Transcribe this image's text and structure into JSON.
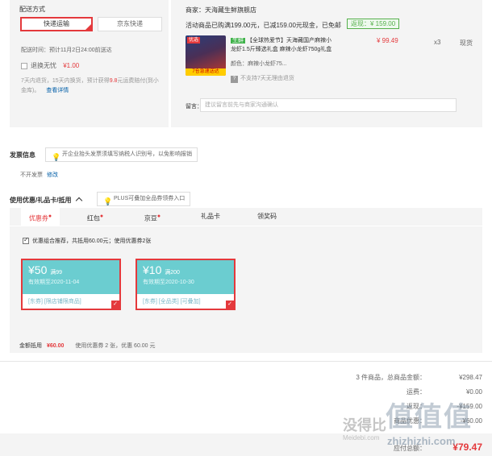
{
  "delivery": {
    "title": "配送方式",
    "options": [
      "快递运输",
      "京东快递"
    ],
    "selected_index": 0,
    "time_label": "配送时间：",
    "time_value": "预计11月2日24:00前送达",
    "return_insurance_label": "退换无忧",
    "return_insurance_price": "¥1.00",
    "return_insurance_desc_1": "7天内退货，15天内换货，预计获得",
    "return_insurance_amount": "9.8",
    "return_insurance_desc_2": "元运费赔付(到小",
    "return_insurance_desc_3": "金库)。",
    "return_insurance_link": "查看详情"
  },
  "shop": {
    "merchant_label": "商家：",
    "merchant_name": "天海藏生鲜旗舰店",
    "promo_text": "活动商品已购满199.00元，已减159.00元现金，已免邮",
    "return_badge": "返现：¥ 159.00",
    "product": {
      "image_corner": "优选",
      "image_label": "7仓急速送达",
      "tag": "生鲜",
      "name_line1": "【全球热爱节】天海藏国产麻辣小",
      "name_line2": "龙虾1.5斤臻选礼盒 麻辣小龙虾750g礼盒",
      "price": "¥ 99.49",
      "qty": "x3",
      "stock": "现货",
      "color_label": "颜色：",
      "color_value": "麻辣小龙虾75...",
      "no_return_icon": "?",
      "no_return": "不支持7天无理由退货"
    },
    "note_label": "留言：",
    "note_placeholder": "建议留言前先与商家沟通确认"
  },
  "invoice": {
    "title": "发票信息",
    "hint": "开企业抬头发票须填写纳税人识别号，以免影响报销",
    "value": "不开发票",
    "modify": "修改"
  },
  "coupons": {
    "title": "使用优惠/礼品卡/抵用",
    "toggle_icon": "chevron-up-icon",
    "hint": "PLUS可叠加全品券领券入口",
    "tabs": [
      {
        "label": "优惠券",
        "dot": true
      },
      {
        "label": "红包",
        "dot": true
      },
      {
        "label": "京豆",
        "dot": true
      },
      {
        "label": "礼品卡",
        "dot": false
      },
      {
        "label": "领奖码",
        "dot": false
      }
    ],
    "active_tab": 0,
    "recommend_text": "优惠组合推荐，共抵用60.00元；使用优惠券2张",
    "items": [
      {
        "amount": "¥50",
        "condition": "满99",
        "expire": "有效期至2020-11-04",
        "tags": "[东券] [限店铺限商品]"
      },
      {
        "amount": "¥10",
        "condition": "满200",
        "expire": "有效期至2020-10-30",
        "tags": "[东券] [全品类] [可叠加]"
      }
    ],
    "summary_label": "金额抵用",
    "summary_amount": "¥60.00",
    "summary_desc": "使用优惠券 2 张，优惠 60.00 元"
  },
  "totals": {
    "goods_label": "3 件商品，总商品金额：",
    "goods_value": "¥298.47",
    "freight_label": "运费：",
    "freight_value": "¥0.00",
    "cashback_label": "返现：",
    "cashback_value": "-¥159.00",
    "coupon_label": "商品优惠：",
    "coupon_value": "-¥60.00",
    "payable_label": "应付总额：",
    "payable_value": "¥79.47"
  },
  "watermark": {
    "text1": "没得比",
    "text2": "Meidebi.com",
    "text3": "值值值",
    "text4": "zhizhizhi.com"
  },
  "colors": {
    "accent": "#e4393c",
    "coupon": "#6bcdd0",
    "panel": "#f4f4f4"
  }
}
